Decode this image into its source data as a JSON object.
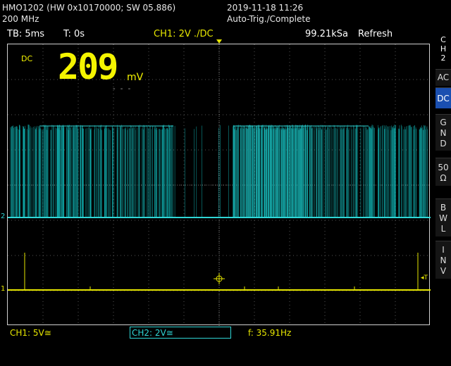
{
  "header": {
    "device": "HMO1202 (HW 0x10170000; SW 05.886)",
    "bandwidth": "200 MHz",
    "datetime": "2019-11-18 11:26",
    "trigger_status": "Auto-Trig./Complete"
  },
  "toolbar": {
    "timebase": "TB: 5ms",
    "trigger_time": "T: 0s",
    "trigger_source": "CH1: 2V ./DC",
    "sample_rate": "99.21kSa",
    "acq_mode": "Refresh"
  },
  "measurement": {
    "coupling": "DC",
    "value": "209",
    "unit": "mV",
    "placeholder": "- - -"
  },
  "markers": {
    "ch2": "2",
    "ch1": "1",
    "trigger_right": "◂T"
  },
  "sidebar": {
    "title": [
      "C",
      "H",
      "2"
    ],
    "buttons": [
      {
        "lines": [
          "AC"
        ],
        "active": false
      },
      {
        "lines": [
          "DC"
        ],
        "active": true
      },
      {
        "lines": [
          "G",
          "N",
          "D"
        ],
        "active": false
      },
      {
        "lines": [
          "50",
          "Ω"
        ],
        "active": false
      },
      {
        "lines": [
          "B",
          "W",
          "L"
        ],
        "active": false
      },
      {
        "lines": [
          "I",
          "N",
          "V"
        ],
        "active": false
      }
    ]
  },
  "footer": {
    "ch1": "CH1: 5V≅",
    "ch2": "CH2: 2V≅",
    "frequency": "f: 35.91Hz"
  },
  "colors": {
    "ch1": "#e6e600",
    "ch2": "#2fd6d6",
    "active_button": "#1a4fb0"
  }
}
